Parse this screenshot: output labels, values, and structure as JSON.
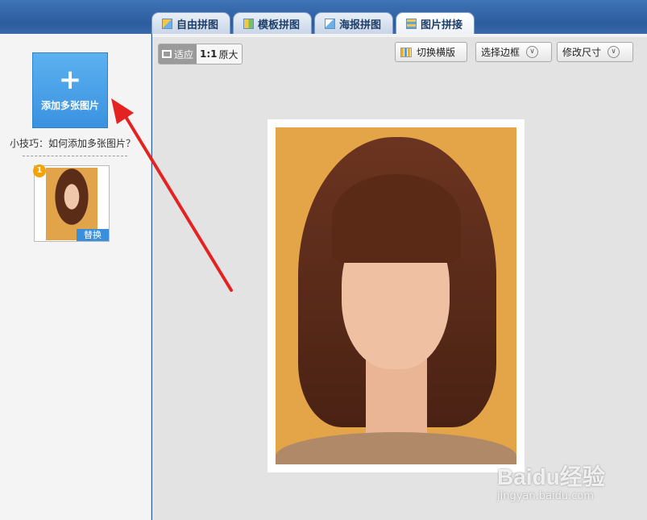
{
  "tabs": [
    {
      "label": "自由拼图",
      "icon": "free-collage-icon"
    },
    {
      "label": "模板拼图",
      "icon": "template-collage-icon"
    },
    {
      "label": "海报拼图",
      "icon": "poster-collage-icon"
    },
    {
      "label": "图片拼接",
      "icon": "image-stitch-icon",
      "active": true
    }
  ],
  "left_panel": {
    "add_button": {
      "icon": "plus-icon",
      "label": "添加多张图片"
    },
    "tip": "小技巧：如何添加多张图片？",
    "thumbnails": [
      {
        "index": "1",
        "replace_label": "替换"
      }
    ]
  },
  "toolbar": {
    "fit_label": "适应",
    "actual_size_prefix": "1:1",
    "actual_size_label": "原大",
    "switch_layout_label": "切换横版",
    "select_border_label": "选择边框",
    "modify_size_label": "修改尺寸"
  },
  "watermark": {
    "brand": "Baidu经验",
    "site": "jingyan.baidu.com"
  },
  "colors": {
    "accent": "#3a92e0",
    "annotation_arrow": "#e52222",
    "badge": "#f5a300"
  }
}
